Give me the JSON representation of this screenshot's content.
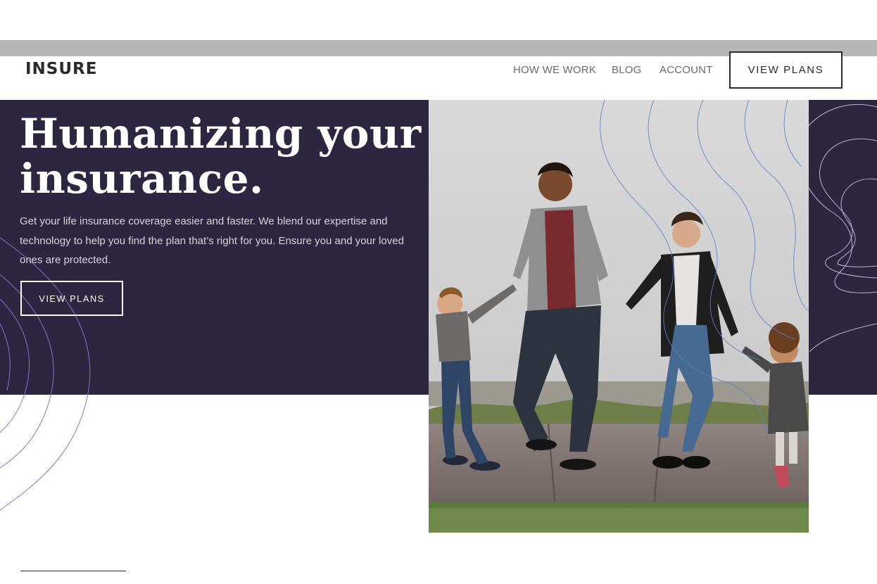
{
  "header": {
    "logo": "INSURE",
    "nav": [
      {
        "label": "HOW WE WORK"
      },
      {
        "label": "BLOG"
      },
      {
        "label": "ACCOUNT"
      }
    ],
    "cta_label": "VIEW PLANS"
  },
  "hero": {
    "title_line1": "Humanizing your",
    "title_line2": "insurance.",
    "description": "Get your life insurance coverage easier and faster. We blend our expertise and technology to help you find the plan that’s right for you. Ensure you and your loved ones are protected.",
    "button_label": "VIEW PLANS"
  },
  "colors": {
    "hero_bg": "#2c2640",
    "text_dark": "#2c2830",
    "nav_text": "#6b6772",
    "contour_light": "#7f78c8",
    "contour_photo": "#5a7fc8"
  }
}
